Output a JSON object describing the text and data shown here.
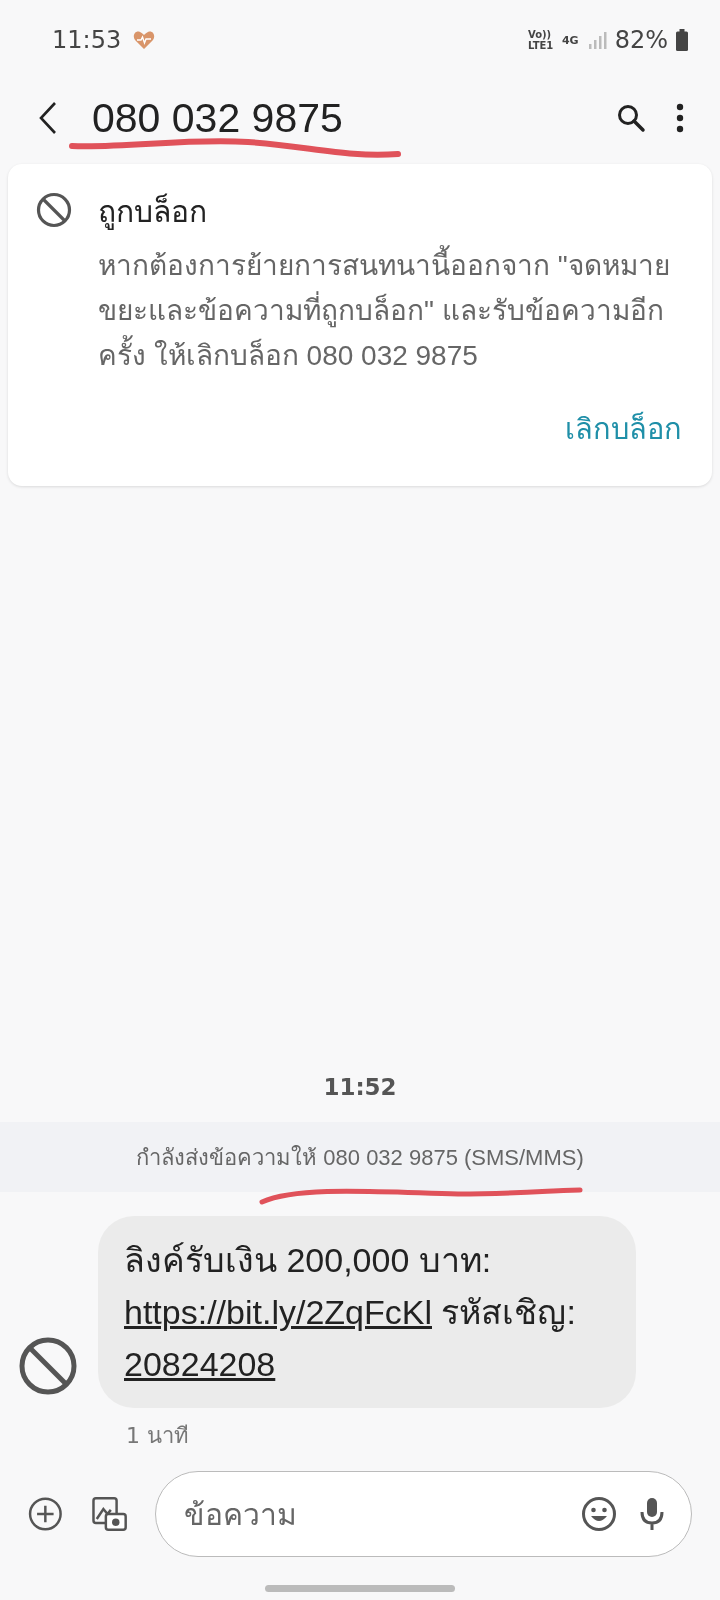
{
  "status_bar": {
    "time": "11:53",
    "network": "4G",
    "volte": "Vo)) LTE1",
    "battery": "82%"
  },
  "header": {
    "title": "080 032 9875"
  },
  "blocked_card": {
    "title": "ถูกบล็อก",
    "body": "หากต้องการย้ายการสนทนานี้ออกจาก \"จดหมายขยะและข้อความที่ถูกบล็อก\" และรับข้อความอีกครั้ง ให้เลิกบล็อก 080 032 9875",
    "action": "เลิกบล็อก"
  },
  "conversation": {
    "time": "11:52",
    "sending_to": "กำลังส่งข้อความให้ 080 032 9875 (SMS/MMS)",
    "messages": [
      {
        "segments": [
          {
            "text": "ลิงค์รับเงิน 200,000 บาท: ",
            "link": false
          },
          {
            "text": "https://bit.ly/2ZqFcKl",
            "link": true
          },
          {
            "text": " รหัสเชิญ:",
            "link": false
          },
          {
            "text": "20824208",
            "link": true
          }
        ],
        "sender_blocked": true,
        "age": "1 นาที"
      }
    ]
  },
  "composer": {
    "placeholder": "ข้อความ"
  }
}
